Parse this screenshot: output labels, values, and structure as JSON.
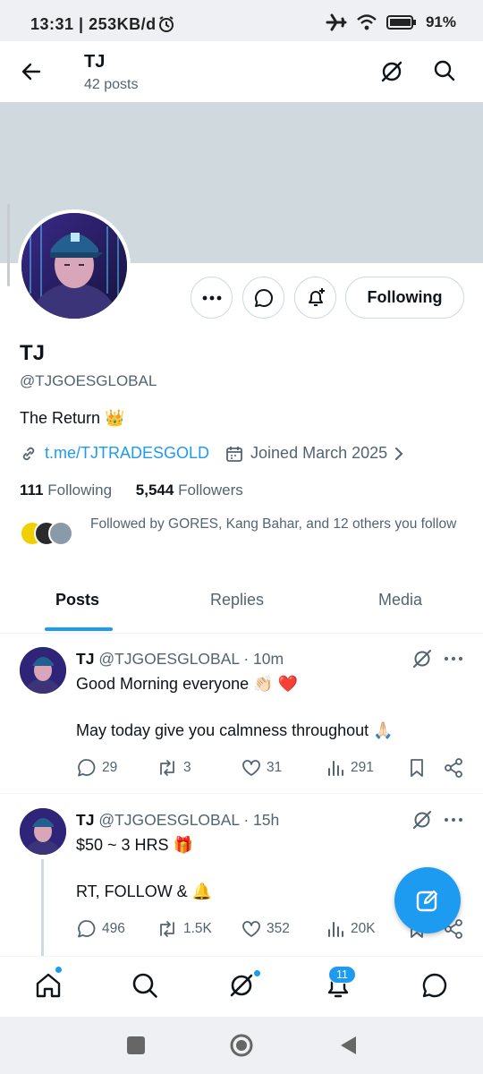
{
  "status_bar": {
    "time": "13:31 | 253KB/d",
    "battery": "91%"
  },
  "header": {
    "title": "TJ",
    "subtitle": "42 posts"
  },
  "profile": {
    "name": "TJ",
    "handle": "@TJGOESGLOBAL",
    "bio": "The Return 👑",
    "link": "t.me/TJTRADESGOLD",
    "joined": "Joined March 2025",
    "following_count": "111",
    "following_label": "Following",
    "followers_count": "5,544",
    "followers_label": "Followers",
    "followed_by": "Followed by GORES, Kang Bahar, and 12 others you follow",
    "follow_button": "Following"
  },
  "tabs": [
    {
      "label": "Posts",
      "active": true
    },
    {
      "label": "Replies",
      "active": false
    },
    {
      "label": "Media",
      "active": false
    }
  ],
  "posts": [
    {
      "name": "TJ",
      "handle": "@TJGOESGLOBAL",
      "time": "· 10m",
      "line1": "Good Morning everyone 👏🏻 ❤️",
      "line2": "May today give you calmness throughout 🙏🏻",
      "replies": "29",
      "reposts": "3",
      "likes": "31",
      "views": "291"
    },
    {
      "name": "TJ",
      "handle": "@TJGOESGLOBAL",
      "time": "· 15h",
      "line1": "$50 ~ 3 HRS 🎁",
      "line2": "RT, FOLLOW & 🔔",
      "replies": "496",
      "reposts": "1.5K",
      "likes": "352",
      "views": "20K"
    }
  ],
  "bottom_nav": {
    "notifications_badge": "11"
  },
  "colors": {
    "accent": "#1d9bf0",
    "text": "#0f1419",
    "muted": "#536471",
    "banner": "#cfd9de"
  }
}
